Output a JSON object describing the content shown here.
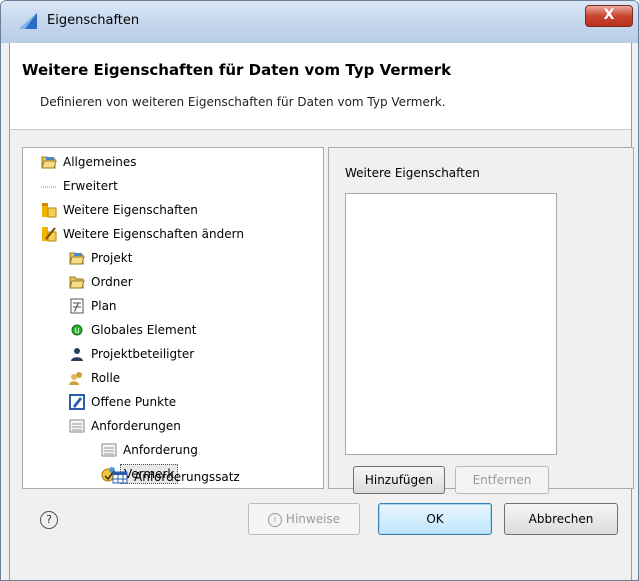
{
  "window": {
    "title": "Eigenschaften",
    "close_label": "X"
  },
  "header": {
    "title": "Weitere Eigenschaften für Daten vom Typ Vermerk",
    "description": "Definieren von weiteren Eigenschaften für Daten vom Typ Vermerk."
  },
  "tree": {
    "items": [
      {
        "label": "Allgemeines",
        "icon": "folder-open-icon"
      },
      {
        "label": "Erweitert",
        "icon": "dotted-line-icon"
      },
      {
        "label": "Weitere Eigenschaften",
        "icon": "properties-icon"
      },
      {
        "label": "Weitere Eigenschaften ändern",
        "icon": "edit-properties-icon"
      },
      {
        "label": "Projekt",
        "icon": "folder-open-icon"
      },
      {
        "label": "Ordner",
        "icon": "folder-open-icon"
      },
      {
        "label": "Plan",
        "icon": "plan-icon"
      },
      {
        "label": "Globales Element",
        "icon": "globe-element-icon"
      },
      {
        "label": "Projektbeteiligter",
        "icon": "person-icon"
      },
      {
        "label": "Rolle",
        "icon": "role-icon"
      },
      {
        "label": "Offene Punkte",
        "icon": "open-points-icon"
      },
      {
        "label": "Anforderungen",
        "icon": "list-icon"
      },
      {
        "label": "Anforderung",
        "icon": "list-icon"
      },
      {
        "label": "Vermerk",
        "icon": "note-icon",
        "selected": true
      },
      {
        "label": "Anforderungssatz",
        "icon": "table-icon"
      }
    ]
  },
  "right_panel": {
    "label": "Weitere Eigenschaften",
    "add_button": "Hinzufügen",
    "remove_button": "Entfernen"
  },
  "footer": {
    "help_label": "?",
    "hints_button": "Hinweise",
    "hints_icon_glyph": "i",
    "ok_button": "OK",
    "cancel_button": "Abbrechen"
  }
}
